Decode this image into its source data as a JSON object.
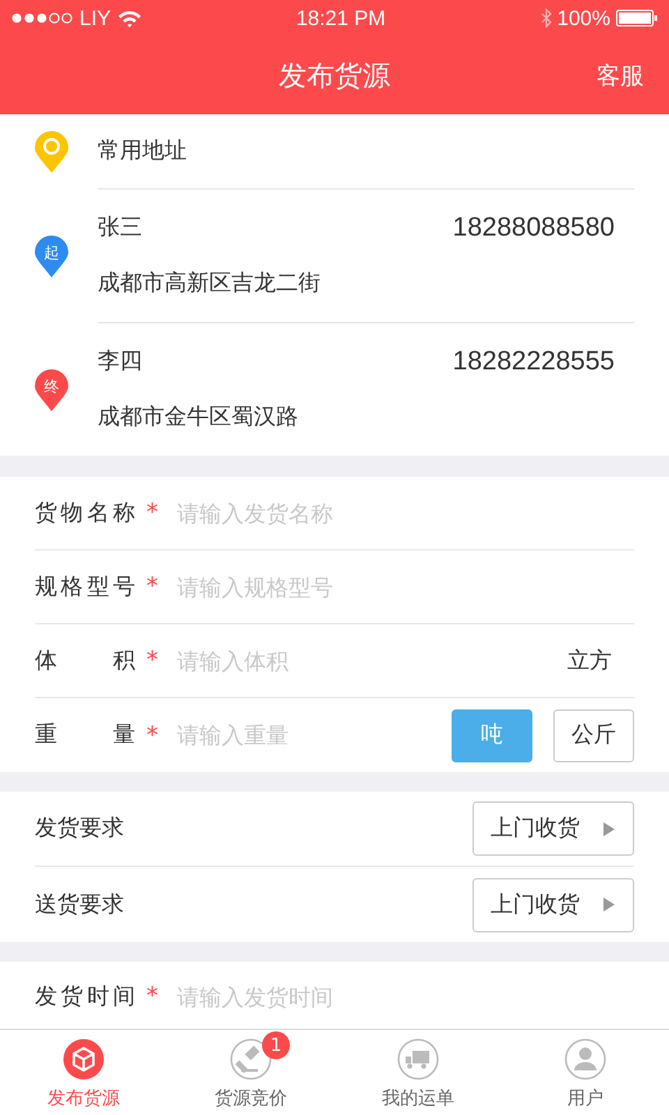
{
  "status_bar": {
    "carrier": "LIY",
    "time": "18:21 PM",
    "battery": "100%"
  },
  "nav": {
    "title": "发布货源",
    "action": "客服"
  },
  "addresses": [
    {
      "kind": "common",
      "label": "常用地址"
    },
    {
      "kind": "start",
      "badge": "起",
      "name": "张三",
      "phone": "18288088580",
      "address": "成都市高新区吉龙二街",
      "color": "#2e8bf0"
    },
    {
      "kind": "end",
      "badge": "终",
      "name": "李四",
      "phone": "18282228555",
      "address": "成都市金牛区蜀汉路",
      "color": "#fc4a4c"
    }
  ],
  "cargo_fields": [
    {
      "kind": "plain",
      "label": "货物名称",
      "required_mark": "*",
      "placeholder": "请输入发货名称"
    },
    {
      "kind": "plain",
      "label": "规格型号",
      "required_mark": "*",
      "placeholder": "请输入规格型号"
    },
    {
      "kind": "unit_text",
      "label": "体 积",
      "required_mark": "*",
      "placeholder": "请输入体积",
      "unit": "立方"
    },
    {
      "kind": "unit_toggle",
      "label": "重 量",
      "required_mark": "*",
      "placeholder": "请输入重量",
      "units": [
        {
          "label": "吨",
          "selected": true
        },
        {
          "label": "公斤",
          "selected": false
        }
      ]
    }
  ],
  "requirements": [
    {
      "label": "发货要求",
      "value": "上门收货"
    },
    {
      "label": "送货要求",
      "value": "上门收货"
    }
  ],
  "time_field": {
    "label": "发货时间",
    "required_mark": "*",
    "placeholder": "请输入发货时间"
  },
  "tabs": [
    {
      "label": "发布货源",
      "selected": true
    },
    {
      "label": "货源竞价",
      "selected": false,
      "badge": "1"
    },
    {
      "label": "我的运单",
      "selected": false
    },
    {
      "label": "用户",
      "selected": false
    }
  ]
}
